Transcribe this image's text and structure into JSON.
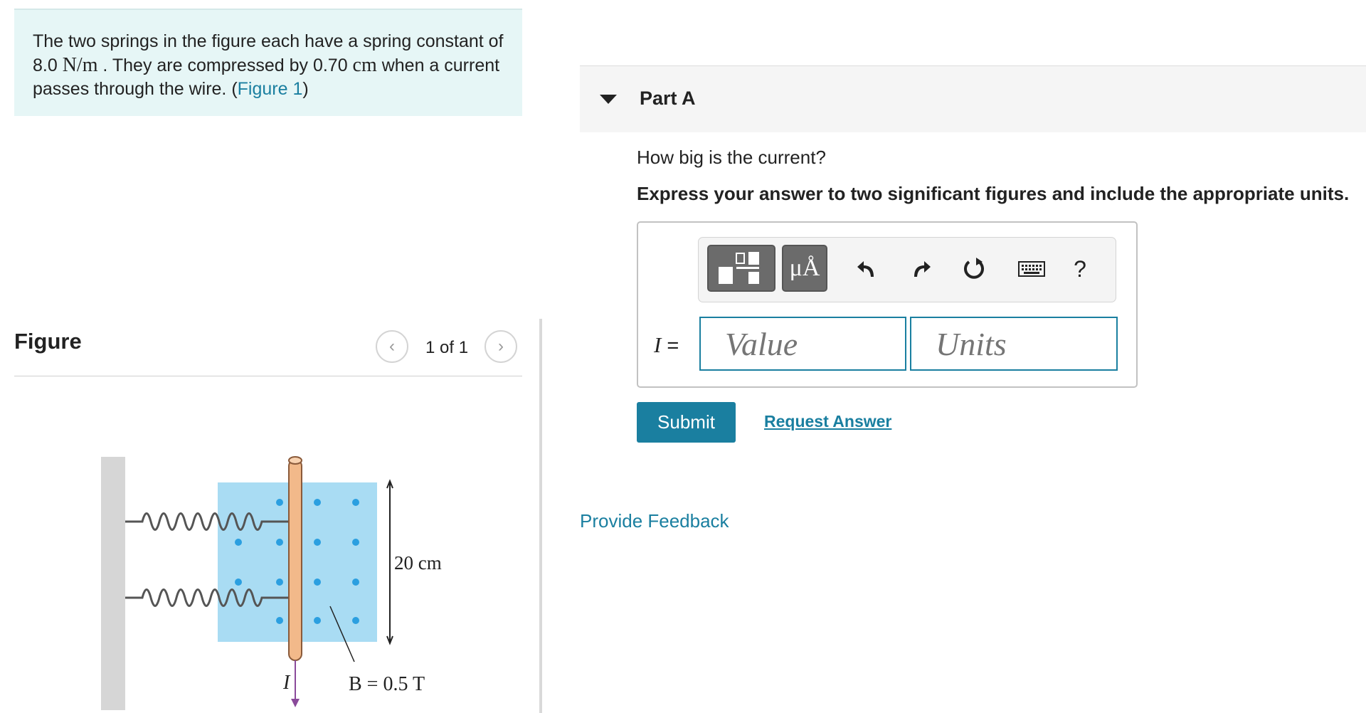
{
  "problem": {
    "text_1": "The two springs in the figure each have a spring constant of 8.0 ",
    "k_value": "N/m",
    "text_2": " . They are compressed by 0.70 ",
    "compression_unit": "cm",
    "text_3": " when a current passes through the wire. (",
    "figure_link": "Figure 1",
    "text_4": ")"
  },
  "figure": {
    "title": "Figure",
    "counter": "1 of 1",
    "prev_icon": "chevron-left-icon",
    "next_icon": "chevron-right-icon",
    "length_label": "20 cm",
    "field_label": "B = 0.5 T",
    "current_label": "I"
  },
  "part": {
    "title": "Part A",
    "question": "How big is the current?",
    "instructions": "Express your answer to two significant figures and include the appropriate units."
  },
  "toolbar": {
    "units_label": "μÅ",
    "help_label": "?",
    "icons": [
      "templates-icon",
      "units-icon",
      "undo-icon",
      "redo-icon",
      "reset-icon",
      "keyboard-icon",
      "help-icon"
    ]
  },
  "answer": {
    "var_name": "I",
    "equals": " =",
    "value_placeholder": "Value",
    "units_placeholder": "Units"
  },
  "actions": {
    "submit_label": "Submit",
    "request_answer_label": "Request Answer",
    "feedback_label": "Provide Feedback"
  },
  "colors": {
    "accent": "#1a7fa0",
    "problem_bg": "#e6f6f6",
    "field_region": "#a9dcf3",
    "field_dot": "#2b9fe0",
    "wire": "#f2b98a"
  }
}
